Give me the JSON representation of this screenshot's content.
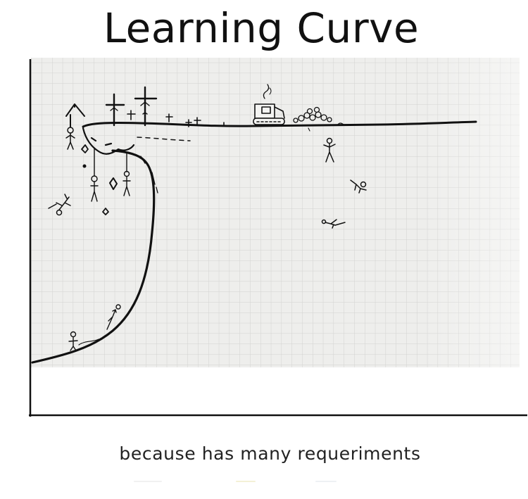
{
  "title": "Learning Curve",
  "caption": "because has many requeriments",
  "colors": {
    "ink": "#111111",
    "paper": "#eeeeec",
    "grid": "#d4d4d2"
  },
  "icons": [
    "cross-icon",
    "tombstone-icon",
    "hanging-figure-icon",
    "falling-figure-icon",
    "bulldozer-icon",
    "stick-figure-icon"
  ]
}
